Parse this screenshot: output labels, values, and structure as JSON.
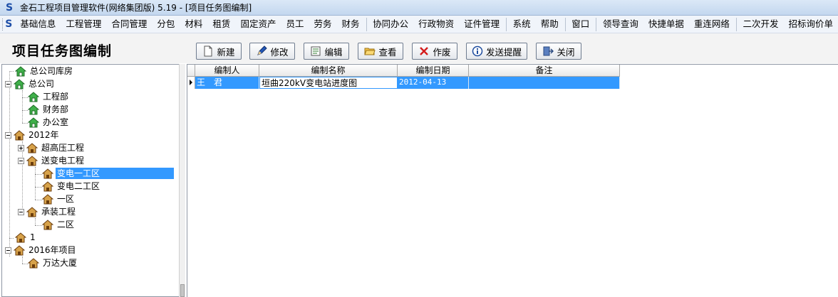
{
  "window": {
    "title": "金石工程项目管理软件(网络集团版) 5.19 - [项目任务图编制]"
  },
  "menu": [
    "基础信息",
    "工程管理",
    "合同管理",
    "分包",
    "材料",
    "租赁",
    "固定资产",
    "员工",
    "劳务",
    "财务",
    "协同办公",
    "行政物资",
    "证件管理",
    "系统",
    "帮助",
    "窗口",
    "领导查询",
    "快捷单据",
    "重连网络",
    "二次开发",
    "招标询价单"
  ],
  "page_title": "项目任务图编制",
  "toolbar": {
    "new": "新建",
    "edit": "修改",
    "compile": "编辑",
    "view": "查看",
    "void": "作废",
    "remind": "发送提醒",
    "close": "关闭"
  },
  "tree": [
    {
      "label": "总公司库房"
    },
    {
      "label": "总公司"
    },
    {
      "label": "工程部"
    },
    {
      "label": "财务部"
    },
    {
      "label": "办公室"
    },
    {
      "label": "2012年"
    },
    {
      "label": "超高压工程"
    },
    {
      "label": "送变电工程"
    },
    {
      "label": "变电一工区",
      "selected": true
    },
    {
      "label": "变电二工区"
    },
    {
      "label": "一区"
    },
    {
      "label": "承装工程"
    },
    {
      "label": "二区"
    },
    {
      "label": "1"
    },
    {
      "label": "2016年项目"
    },
    {
      "label": "万达大厦"
    }
  ],
  "grid": {
    "columns": [
      "编制人",
      "编制名称",
      "编制日期",
      "备注"
    ],
    "rows": [
      {
        "author": "王　君",
        "name": "垣曲220kV变电站进度图",
        "date": "2012-04-13",
        "note": ""
      }
    ]
  },
  "colors": {
    "selection": "#3399ff",
    "title_bar": "#c3d7ef",
    "icon_green": "#2e9b3a",
    "icon_brown": "#8a5a1a"
  }
}
